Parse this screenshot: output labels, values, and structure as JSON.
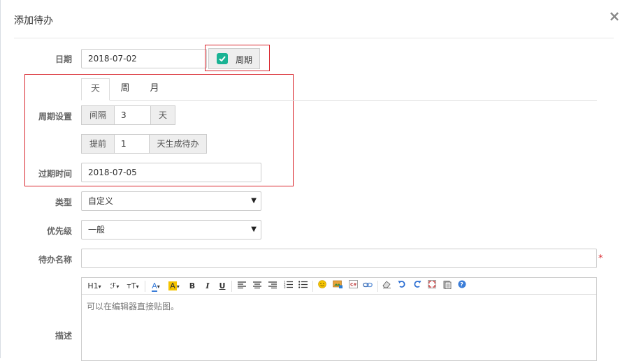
{
  "modal": {
    "title": "添加待办",
    "close": "×"
  },
  "form": {
    "date_label": "日期",
    "date_value": "2018-07-02",
    "period_button": "周期",
    "period_settings_label": "周期设置",
    "tabs": [
      "天",
      "周",
      "月"
    ],
    "interval_label": "间隔",
    "interval_value": "3",
    "interval_unit": "天",
    "advance_label": "提前",
    "advance_value": "1",
    "advance_suffix": "天生成待办",
    "expire_label": "过期时间",
    "expire_value": "2018-07-05",
    "type_label": "类型",
    "type_value": "自定义",
    "priority_label": "优先级",
    "priority_value": "一般",
    "name_label": "待办名称",
    "name_value": "",
    "required_mark": "*",
    "desc_label": "描述",
    "editor_placeholder": "可以在编辑器直接贴图。"
  },
  "toolbar": {
    "heading": "H1",
    "font_family": "ℱ",
    "font_size": "ᴛT",
    "font_color": "A",
    "highlight": "A",
    "bold": "B",
    "italic": "I",
    "underline": "U",
    "dropdown": "▾"
  },
  "colors": {
    "accent": "#1ab394",
    "highlight_box": "#d9272e",
    "required": "#d9272e"
  }
}
